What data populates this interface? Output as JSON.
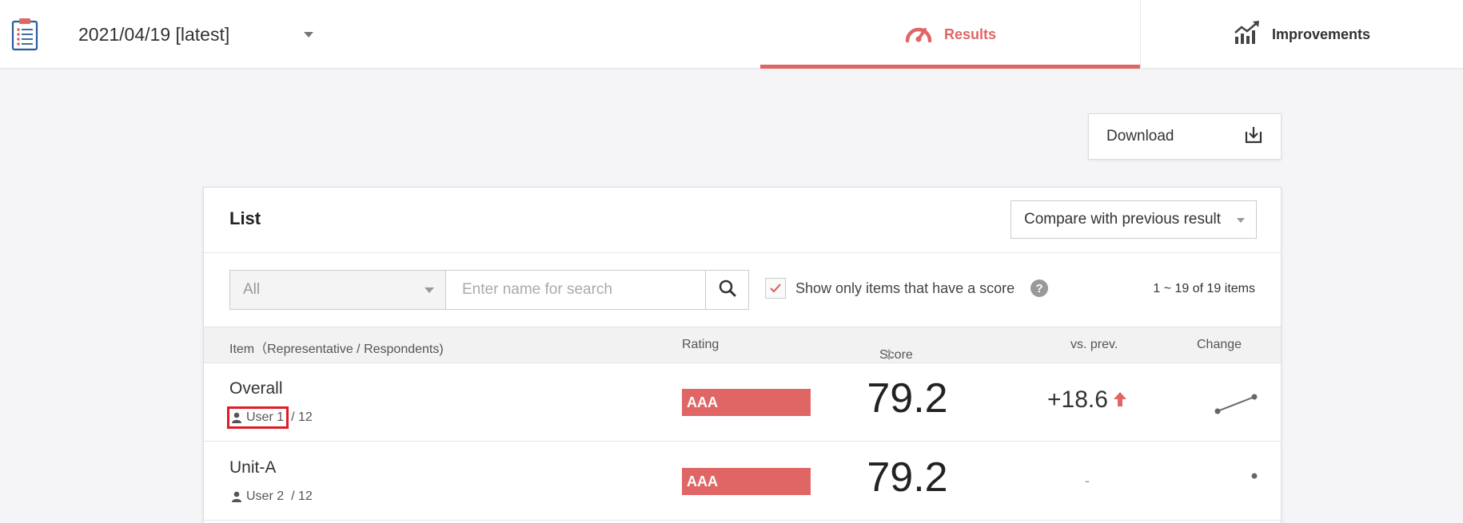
{
  "header": {
    "date_selector": {
      "value": "2021/04/19 [latest]"
    },
    "tabs": [
      {
        "label": "Results",
        "active": true,
        "icon": "speedometer-icon"
      },
      {
        "label": "Improvements",
        "active": false,
        "icon": "growth-chart-icon"
      }
    ]
  },
  "toolbar": {
    "download_label": "Download",
    "download_icon": "download-icon"
  },
  "list": {
    "title": "List",
    "compare_select": {
      "value": "Compare with previous result"
    },
    "filters": {
      "category": {
        "value": "All"
      },
      "search": {
        "placeholder": "Enter name for search",
        "value": ""
      },
      "score_only": {
        "label": "Show only items that have a score",
        "checked": true
      },
      "count_text": "1 ~ 19 of 19 items"
    },
    "columns": {
      "item": "Item（Representative / Respondents)",
      "rating": "Rating",
      "score": "Score",
      "vs_prev": "vs. prev.",
      "change": "Change"
    },
    "rows": [
      {
        "name": "Overall",
        "representative": "User 1",
        "respondents": "/ 12",
        "rating": "AAA",
        "score": "79.2",
        "vs_prev": "+18.6",
        "trend": "up"
      },
      {
        "name": "Unit-A",
        "representative": "User 2",
        "respondents": "/ 12",
        "rating": "AAA",
        "score": "79.2",
        "vs_prev": "-",
        "trend": "none"
      }
    ]
  },
  "colors": {
    "accent": "#e06666",
    "highlight": "#e01b24"
  }
}
